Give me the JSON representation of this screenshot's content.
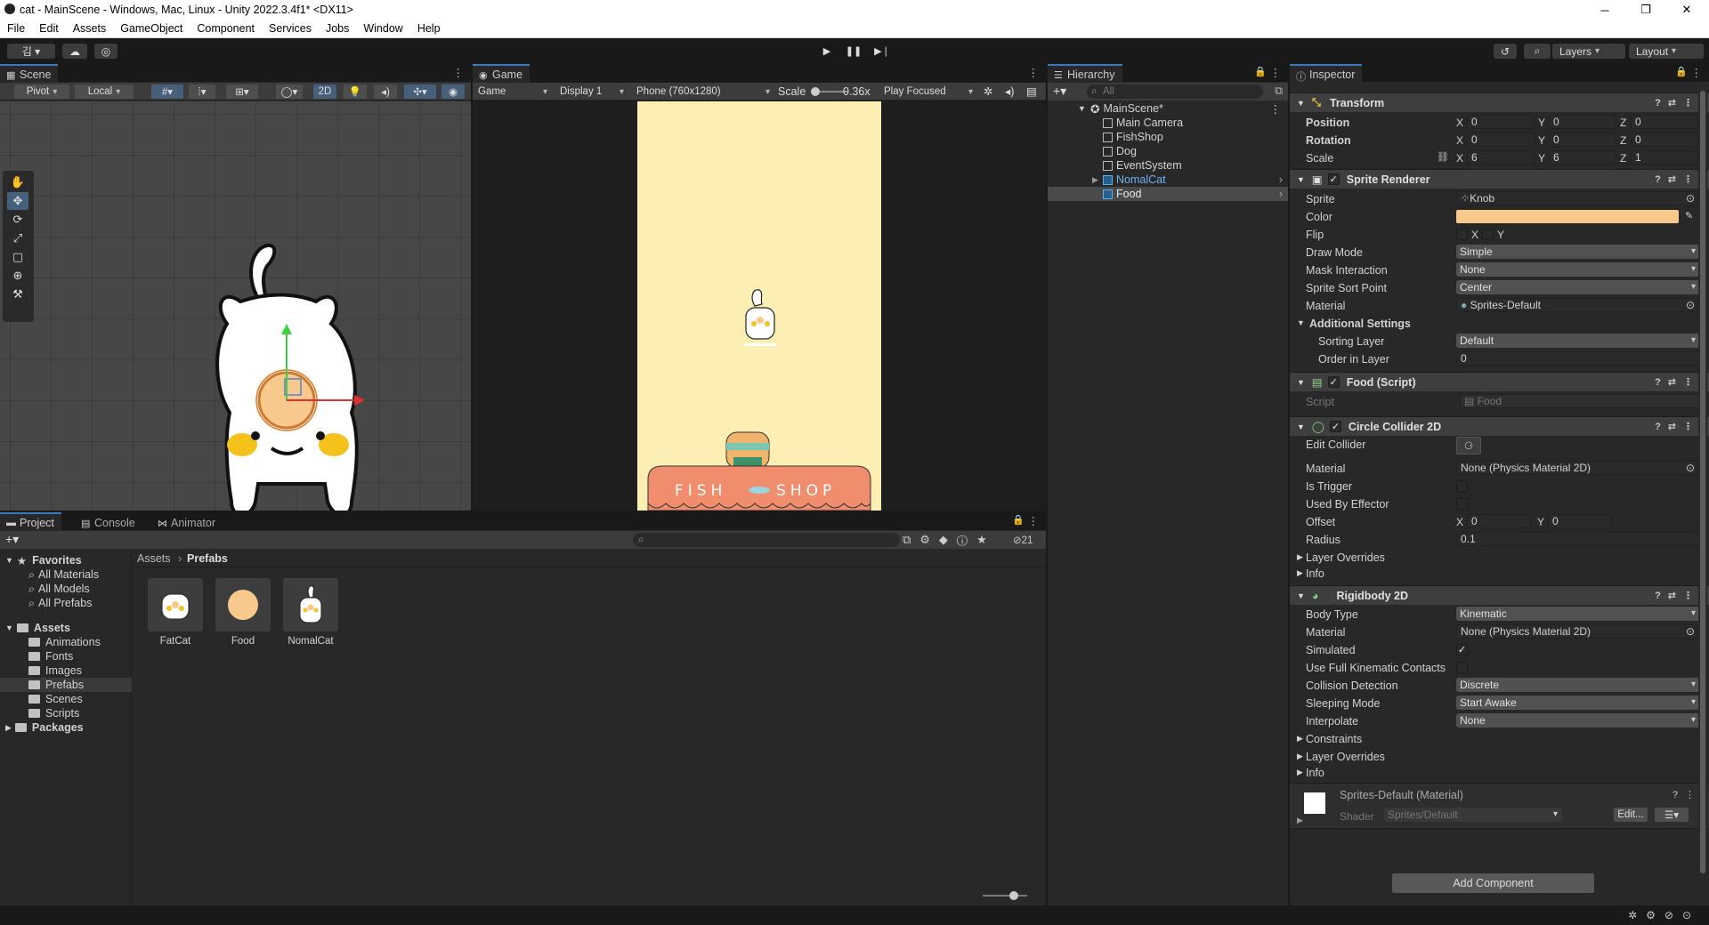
{
  "window": {
    "title": "cat - MainScene - Windows, Mac, Linux - Unity 2022.3.4f1* <DX11>",
    "min": "─",
    "max": "❐",
    "close": "✕"
  },
  "menu": [
    "File",
    "Edit",
    "Assets",
    "GameObject",
    "Component",
    "Services",
    "Jobs",
    "Window",
    "Help"
  ],
  "toolbar": {
    "account": "김 ▾",
    "layers": "Layers",
    "layout": "Layout"
  },
  "scene": {
    "tab": "Scene",
    "pivot": "Pivot",
    "local": "Local",
    "mode2d": "2D"
  },
  "game": {
    "tab": "Game",
    "view": "Game",
    "display": "Display 1",
    "resolution": "Phone (760x1280)",
    "scale_label": "Scale",
    "scale_value": "0.36x",
    "play_focused": "Play Focused",
    "shop_text_1": "FISH",
    "shop_text_2": "SHOP",
    "bg_color": "#fdeeb4"
  },
  "hierarchy": {
    "tab": "Hierarchy",
    "search_placeholder": "All",
    "scene_name": "MainScene*",
    "items": [
      "Main Camera",
      "FishShop",
      "Dog",
      "EventSystem",
      "NomalCat",
      "Food"
    ]
  },
  "inspector": {
    "tab": "Inspector",
    "transform": {
      "header": "Transform",
      "position": {
        "label": "Position",
        "x": "0",
        "y": "0",
        "z": "0"
      },
      "rotation": {
        "label": "Rotation",
        "x": "0",
        "y": "0",
        "z": "0"
      },
      "scale": {
        "label": "Scale",
        "x": "6",
        "y": "6",
        "z": "1"
      }
    },
    "sprite_renderer": {
      "header": "Sprite Renderer",
      "sprite_label": "Sprite",
      "sprite": "Knob",
      "color_label": "Color",
      "color": "#f8c98c",
      "flip_label": "Flip",
      "flip_x": "X",
      "flip_y": "Y",
      "draw_mode_label": "Draw Mode",
      "draw_mode": "Simple",
      "mask_label": "Mask Interaction",
      "mask": "None",
      "sort_point_label": "Sprite Sort Point",
      "sort_point": "Center",
      "material_label": "Material",
      "material": "Sprites-Default",
      "additional": "Additional Settings",
      "sorting_layer_label": "Sorting Layer",
      "sorting_layer": "Default",
      "order_label": "Order in Layer",
      "order": "0"
    },
    "food_script": {
      "header": "Food (Script)",
      "script_label": "Script",
      "script": "Food"
    },
    "circle_collider": {
      "header": "Circle Collider 2D",
      "edit_label": "Edit Collider",
      "material_label": "Material",
      "material": "None (Physics Material 2D)",
      "trigger_label": "Is Trigger",
      "effector_label": "Used By Effector",
      "offset_label": "Offset",
      "offset_x": "0",
      "offset_y": "0",
      "radius_label": "Radius",
      "radius": "0.1",
      "layer_overrides": "Layer Overrides",
      "info": "Info"
    },
    "rigidbody": {
      "header": "Rigidbody 2D",
      "body_type_label": "Body Type",
      "body_type": "Kinematic",
      "material_label": "Material",
      "material": "None (Physics Material 2D)",
      "simulated_label": "Simulated",
      "full_kinematic_label": "Use Full Kinematic Contacts",
      "collision_label": "Collision Detection",
      "collision": "Discrete",
      "sleeping_label": "Sleeping Mode",
      "sleeping": "Start Awake",
      "interpolate_label": "Interpolate",
      "interpolate": "None",
      "constraints": "Constraints",
      "layer_overrides": "Layer Overrides",
      "info": "Info"
    },
    "material": {
      "name": "Sprites-Default (Material)",
      "shader_label": "Shader",
      "shader": "Sprites/Default",
      "edit": "Edit..."
    },
    "add_component": "Add Component"
  },
  "project": {
    "tabs": [
      "Project",
      "Console",
      "Animator"
    ],
    "hidden_count": "21",
    "favorites": "Favorites",
    "fav_items": [
      "All Materials",
      "All Models",
      "All Prefabs"
    ],
    "assets": "Assets",
    "asset_folders": [
      "Animations",
      "Fonts",
      "Images",
      "Prefabs",
      "Scenes",
      "Scripts"
    ],
    "packages": "Packages",
    "breadcrumb": [
      "Assets",
      "Prefabs"
    ],
    "prefabs": [
      "FatCat",
      "Food",
      "NomalCat"
    ]
  }
}
